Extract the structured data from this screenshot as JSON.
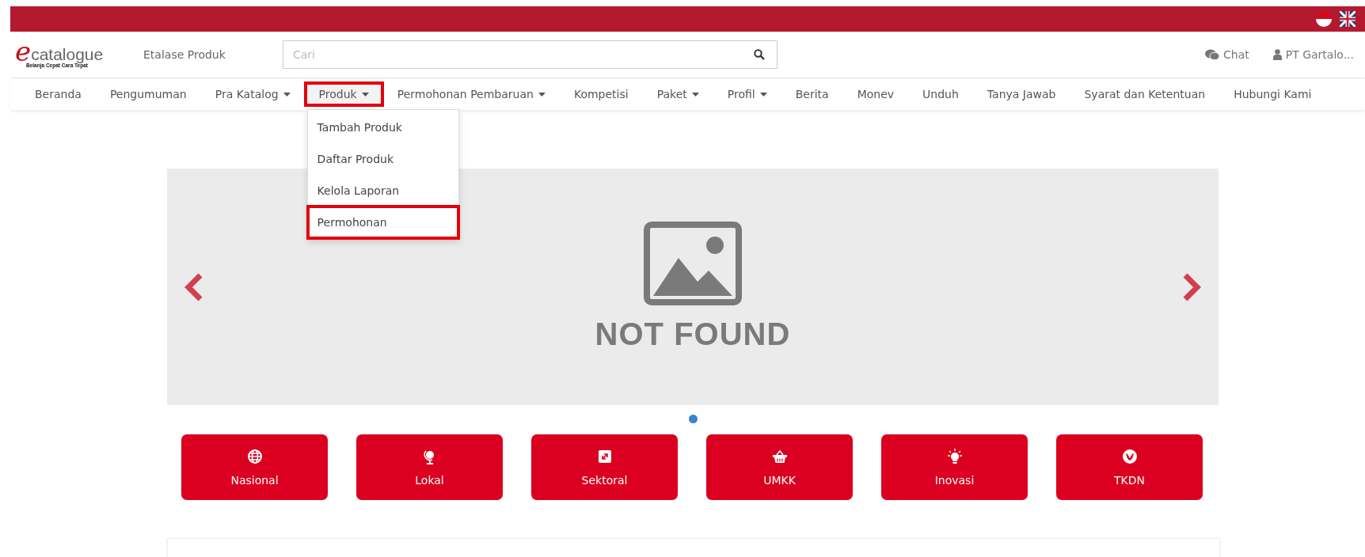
{
  "logo": {
    "mark": "e",
    "name": "catalogue",
    "tagline": "Belanja Cepat Cara Tepat"
  },
  "header": {
    "title": "Etalase Produk",
    "search": {
      "placeholder": "Cari"
    },
    "chat": "Chat",
    "user": "PT Gartalo..."
  },
  "nav": [
    {
      "label": "Beranda",
      "dropdown": false,
      "highlighted": false
    },
    {
      "label": "Pengumuman",
      "dropdown": false,
      "highlighted": false
    },
    {
      "label": "Pra Katalog",
      "dropdown": true,
      "highlighted": false
    },
    {
      "label": "Produk",
      "dropdown": true,
      "highlighted": true
    },
    {
      "label": "Permohonan Pembaruan",
      "dropdown": true,
      "highlighted": false
    },
    {
      "label": "Kompetisi",
      "dropdown": false,
      "highlighted": false
    },
    {
      "label": "Paket",
      "dropdown": true,
      "highlighted": false
    },
    {
      "label": "Profil",
      "dropdown": true,
      "highlighted": false
    },
    {
      "label": "Berita",
      "dropdown": false,
      "highlighted": false
    },
    {
      "label": "Monev",
      "dropdown": false,
      "highlighted": false
    },
    {
      "label": "Unduh",
      "dropdown": false,
      "highlighted": false
    },
    {
      "label": "Tanya Jawab",
      "dropdown": false,
      "highlighted": false
    },
    {
      "label": "Syarat dan Ketentuan",
      "dropdown": false,
      "highlighted": false
    },
    {
      "label": "Hubungi Kami",
      "dropdown": false,
      "highlighted": false
    }
  ],
  "dropdown_menu": [
    {
      "label": "Tambah Produk",
      "highlighted": false
    },
    {
      "label": "Daftar Produk",
      "highlighted": false
    },
    {
      "label": "Kelola Laporan",
      "highlighted": false
    },
    {
      "label": "Permohonan",
      "highlighted": true
    }
  ],
  "carousel": {
    "image_text": "NOT FOUND",
    "indicators": [
      {
        "selected": true
      }
    ]
  },
  "categories": [
    {
      "label": "Nasional",
      "kind": "globe"
    },
    {
      "label": "Lokal",
      "kind": "desk-globe"
    },
    {
      "label": "Sektoral",
      "kind": "expand"
    },
    {
      "label": "UMKK",
      "kind": "basket"
    },
    {
      "label": "Inovasi",
      "kind": "bulb"
    },
    {
      "label": "TKDN",
      "kind": "emblem"
    }
  ]
}
